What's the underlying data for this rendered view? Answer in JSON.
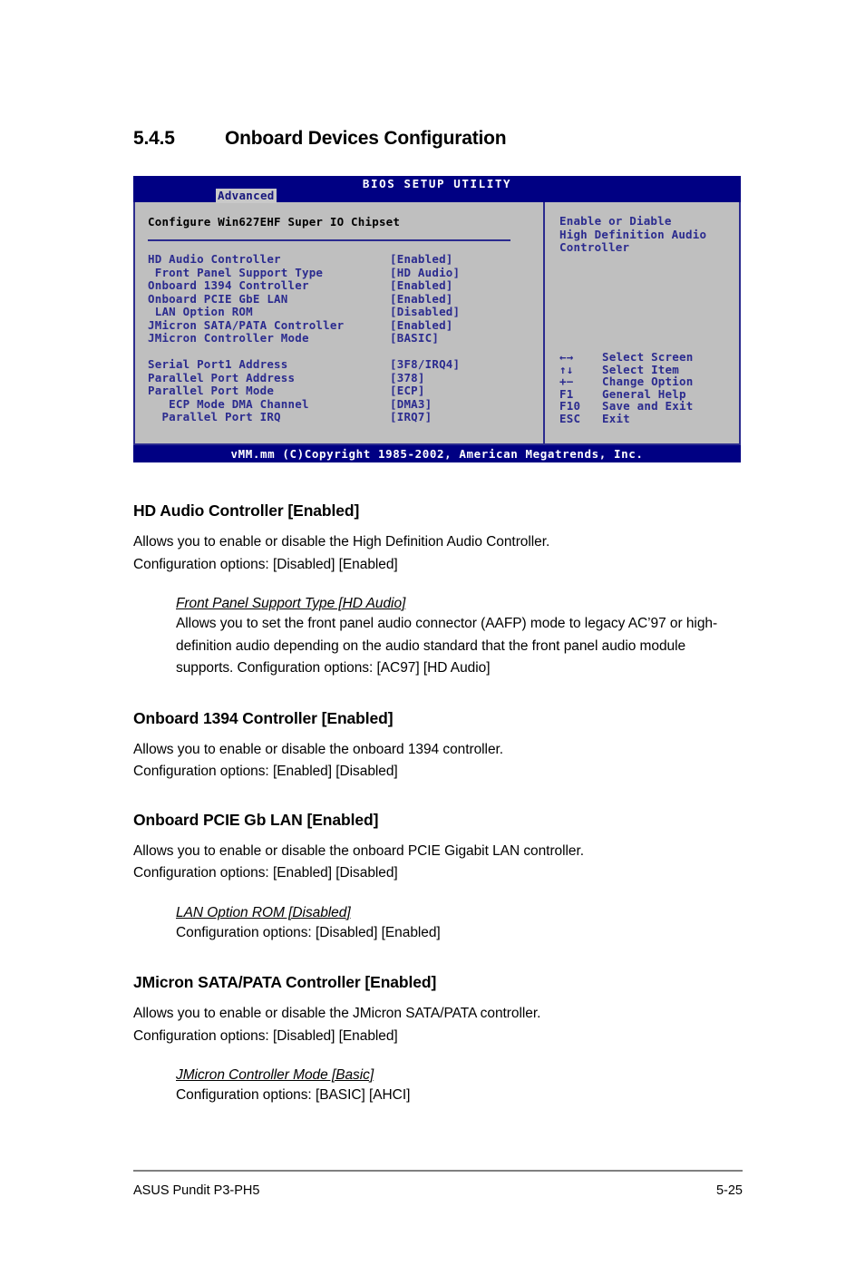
{
  "section": {
    "number": "5.4.5",
    "title": "Onboard Devices Configuration"
  },
  "bios": {
    "title": "BIOS SETUP UTILITY",
    "active_tab": "Advanced",
    "config_header": "Configure Win627EHF Super IO Chipset",
    "items": [
      {
        "label": "HD Audio Controller",
        "value": "[Enabled]"
      },
      {
        "label": " Front Panel Support Type",
        "value": "[HD Audio]"
      },
      {
        "label": "Onboard 1394 Controller",
        "value": "[Enabled]"
      },
      {
        "label": "Onboard PCIE GbE LAN",
        "value": "[Enabled]"
      },
      {
        "label": " LAN Option ROM",
        "value": "[Disabled]"
      },
      {
        "label": "JMicron SATA/PATA Controller",
        "value": "[Enabled]"
      },
      {
        "label": "JMicron Controller Mode",
        "value": "[BASIC]"
      },
      {
        "label": "",
        "value": ""
      },
      {
        "label": "Serial Port1 Address",
        "value": "[3F8/IRQ4]"
      },
      {
        "label": "Parallel Port Address",
        "value": "[378]"
      },
      {
        "label": "Parallel Port Mode",
        "value": "[ECP]"
      },
      {
        "label": "   ECP Mode DMA Channel",
        "value": "[DMA3]"
      },
      {
        "label": "  Parallel Port IRQ",
        "value": "[IRQ7]"
      }
    ],
    "help_text": "Enable or Diable\nHigh Definition Audio\nController",
    "key_legend": [
      {
        "key": "←→",
        "action": "Select Screen"
      },
      {
        "key": "↑↓",
        "action": "Select Item"
      },
      {
        "key": "+−",
        "action": "Change Option"
      },
      {
        "key": "F1",
        "action": "General Help"
      },
      {
        "key": "F10",
        "action": "Save and Exit"
      },
      {
        "key": "ESC",
        "action": "Exit"
      }
    ],
    "footer": "vMM.mm (C)Copyright 1985-2002, American Megatrends, Inc.",
    "colors": {
      "titlebar": "#000083",
      "panel": "#bfbfbf",
      "text_blue": "#2b2b8f",
      "border": "#2b2b8f"
    }
  },
  "content": {
    "blocks": [
      {
        "heading": "HD Audio Controller [Enabled]",
        "para": "Allows you to enable or disable the High Definition Audio Controller.\nConfiguration options: [Disabled] [Enabled]",
        "sub_heading": "Front Panel Support Type [HD Audio]",
        "sub_para": "Allows you to set the front panel audio connector (AAFP) mode to legacy AC’97 or high-definition audio depending on the audio standard that the front panel audio module supports. Configuration options: [AC97] [HD Audio]"
      },
      {
        "heading": "Onboard 1394 Controller [Enabled]",
        "para": "Allows you to enable or disable the onboard 1394 controller.\nConfiguration options: [Enabled] [Disabled]",
        "sub_heading": "",
        "sub_para": ""
      },
      {
        "heading": "Onboard PCIE Gb LAN [Enabled]",
        "para": "Allows you to enable or disable the onboard PCIE Gigabit LAN controller.\nConfiguration options: [Enabled] [Disabled]",
        "sub_heading": "LAN Option ROM [Disabled]",
        "sub_para": "Configuration options: [Disabled] [Enabled]"
      },
      {
        "heading": "JMicron SATA/PATA Controller [Enabled]",
        "para": "Allows you to enable or disable the JMicron SATA/PATA controller.\nConfiguration options: [Disabled] [Enabled]",
        "sub_heading": "JMicron Controller Mode [Basic]",
        "sub_para": "Configuration options: [BASIC] [AHCI]"
      }
    ]
  },
  "page_footer": {
    "left": "ASUS Pundit P3-PH5",
    "right": "5-25"
  }
}
